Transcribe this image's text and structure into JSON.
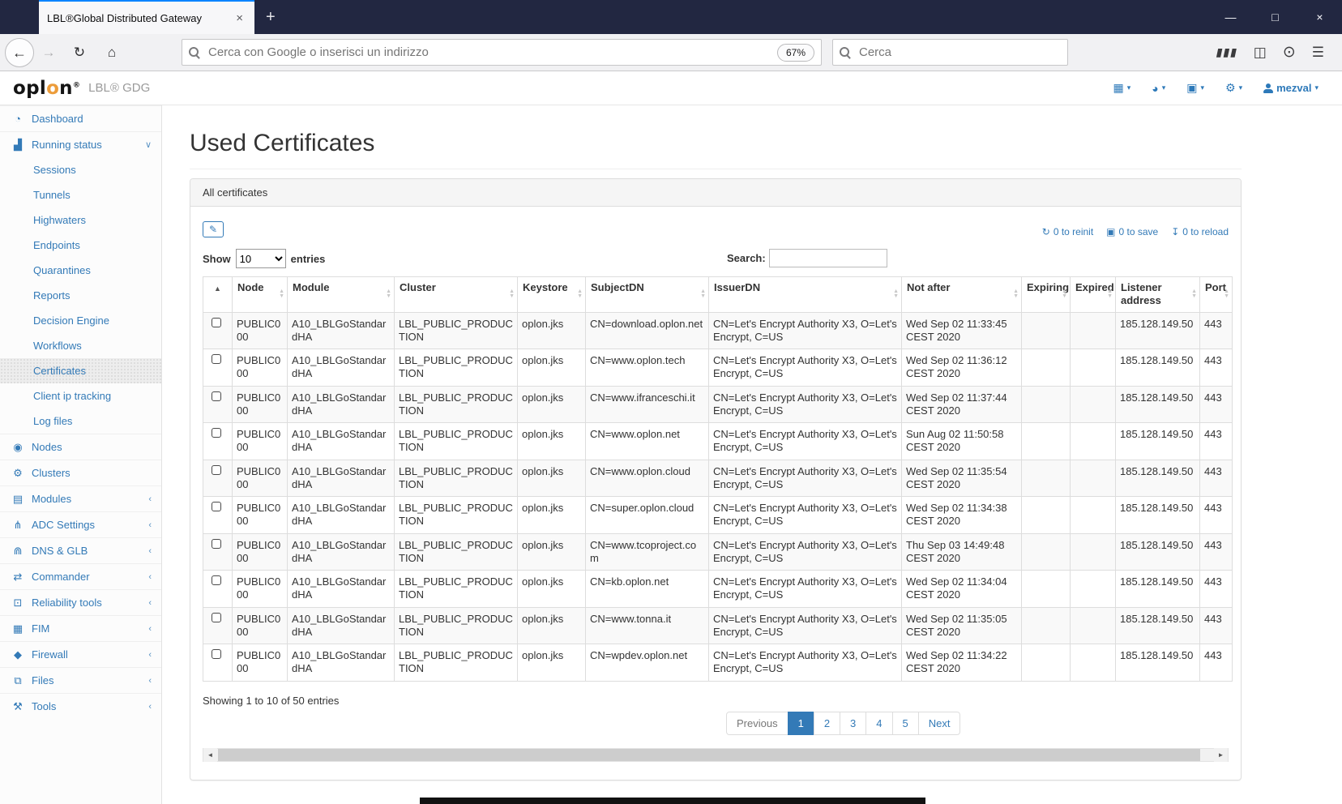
{
  "colors": {
    "accent_blue": "#337ab7",
    "header_icon_blue": "#2d79b9",
    "logo_orange": "#ec9c3a",
    "tabbar_bg": "#222741",
    "tab_accent": "#0a84ff",
    "active_page_bg": "#337ab7",
    "panel_header_bg": "#f5f5f5",
    "row_stripe": "#f9f9f9"
  },
  "browser": {
    "tab": {
      "title": "LBL®Global Distributed Gateway",
      "close": "×",
      "new_tab": "+"
    },
    "window_controls": {
      "minimize": "—",
      "maximize": "□",
      "close": "×"
    },
    "toolbar": {
      "back": "←",
      "forward": "→",
      "reload": "↻",
      "home": "⌂",
      "url_placeholder": "Cerca con Google o inserisci un indirizzo",
      "zoom_badge": "67%",
      "search_placeholder": "Cerca",
      "library_glyph": "▮▮▮",
      "sidebar_glyph": "◫",
      "account_glyph": "⊙",
      "menu_glyph": "☰"
    }
  },
  "app_header": {
    "logo": {
      "pre": "opl",
      "accent": "o",
      "post": "n",
      "reg": "®"
    },
    "product": "LBL® GDG",
    "menus": [
      {
        "name": "apps-menu",
        "icon": "grid-icon",
        "glyph": "▦"
      },
      {
        "name": "dashboard-menu",
        "icon": "gauge-icon",
        "glyph": "◕"
      },
      {
        "name": "save-menu",
        "icon": "floppy-icon",
        "glyph": "▣"
      },
      {
        "name": "settings-menu",
        "icon": "gear-icon",
        "glyph": "⚙"
      }
    ],
    "user_menu": {
      "label": "mezval"
    }
  },
  "sidebar": {
    "items": [
      {
        "label": "Dashboard",
        "icon": "speedometer-icon",
        "glyph": "◔"
      },
      {
        "label": "Running status",
        "icon": "bar-chart-icon",
        "glyph": "▟",
        "state": "expanded",
        "children": [
          "Sessions",
          "Tunnels",
          "Highwaters",
          "Endpoints",
          "Quarantines",
          "Reports",
          "Decision Engine",
          "Workflows",
          "Certificates",
          "Client ip tracking",
          "Log files"
        ],
        "active_child": "Certificates"
      },
      {
        "label": "Nodes",
        "icon": "globe-icon",
        "glyph": "◉"
      },
      {
        "label": "Clusters",
        "icon": "gears-icon",
        "glyph": "⚙"
      },
      {
        "label": "Modules",
        "icon": "list-icon",
        "glyph": "▤",
        "state": "collapsed"
      },
      {
        "label": "ADC Settings",
        "icon": "sitemap-icon",
        "glyph": "⋔",
        "state": "collapsed"
      },
      {
        "label": "DNS & GLB",
        "icon": "binoculars-icon",
        "glyph": "⋒",
        "state": "collapsed"
      },
      {
        "label": "Commander",
        "icon": "shuffle-icon",
        "glyph": "⇄",
        "state": "collapsed"
      },
      {
        "label": "Reliability tools",
        "icon": "desktop-icon",
        "glyph": "⊡",
        "state": "collapsed"
      },
      {
        "label": "FIM",
        "icon": "image-icon",
        "glyph": "▦",
        "state": "collapsed"
      },
      {
        "label": "Firewall",
        "icon": "shield-icon",
        "glyph": "◆",
        "state": "collapsed"
      },
      {
        "label": "Files",
        "icon": "copy-icon",
        "glyph": "⧉",
        "state": "collapsed"
      },
      {
        "label": "Tools",
        "icon": "wrench-icon",
        "glyph": "⚒",
        "state": "collapsed"
      }
    ]
  },
  "main": {
    "title": "Used Certificates",
    "panel": {
      "header": "All certificates",
      "edit_button": {
        "icon": "edit-icon",
        "glyph": "✎"
      },
      "actions": [
        {
          "label": "0 to reinit",
          "icon": "refresh-icon",
          "glyph": "↻"
        },
        {
          "label": "0 to save",
          "icon": "save-icon",
          "glyph": "▣"
        },
        {
          "label": "0 to reload",
          "icon": "download-icon",
          "glyph": "↧"
        }
      ],
      "length_control": {
        "show": "Show",
        "value": "10",
        "entries": "entries"
      },
      "search_label": "Search:",
      "table": {
        "columns": [
          "Node",
          "Module",
          "Cluster",
          "Keystore",
          "SubjectDN",
          "IssuerDN",
          "Not after",
          "Expiring",
          "Expired",
          "Listener address",
          "Port"
        ],
        "rows": [
          {
            "node": "PUBLIC000",
            "module": "A10_LBLGoStandardHA",
            "cluster": "LBL_PUBLIC_PRODUCTION",
            "keystore": "oplon.jks",
            "subject": "CN=download.oplon.net",
            "issuer": "CN=Let's Encrypt Authority X3, O=Let's Encrypt, C=US",
            "not_after": "Wed Sep 02 11:33:45 CEST 2020",
            "expiring": "",
            "expired": "",
            "listener": "185.128.149.50",
            "port": "443"
          },
          {
            "node": "PUBLIC000",
            "module": "A10_LBLGoStandardHA",
            "cluster": "LBL_PUBLIC_PRODUCTION",
            "keystore": "oplon.jks",
            "subject": "CN=www.oplon.tech",
            "issuer": "CN=Let's Encrypt Authority X3, O=Let's Encrypt, C=US",
            "not_after": "Wed Sep 02 11:36:12 CEST 2020",
            "expiring": "",
            "expired": "",
            "listener": "185.128.149.50",
            "port": "443"
          },
          {
            "node": "PUBLIC000",
            "module": "A10_LBLGoStandardHA",
            "cluster": "LBL_PUBLIC_PRODUCTION",
            "keystore": "oplon.jks",
            "subject": "CN=www.ifranceschi.it",
            "issuer": "CN=Let's Encrypt Authority X3, O=Let's Encrypt, C=US",
            "not_after": "Wed Sep 02 11:37:44 CEST 2020",
            "expiring": "",
            "expired": "",
            "listener": "185.128.149.50",
            "port": "443"
          },
          {
            "node": "PUBLIC000",
            "module": "A10_LBLGoStandardHA",
            "cluster": "LBL_PUBLIC_PRODUCTION",
            "keystore": "oplon.jks",
            "subject": "CN=www.oplon.net",
            "issuer": "CN=Let's Encrypt Authority X3, O=Let's Encrypt, C=US",
            "not_after": "Sun Aug 02 11:50:58 CEST 2020",
            "expiring": "",
            "expired": "",
            "listener": "185.128.149.50",
            "port": "443"
          },
          {
            "node": "PUBLIC000",
            "module": "A10_LBLGoStandardHA",
            "cluster": "LBL_PUBLIC_PRODUCTION",
            "keystore": "oplon.jks",
            "subject": "CN=www.oplon.cloud",
            "issuer": "CN=Let's Encrypt Authority X3, O=Let's Encrypt, C=US",
            "not_after": "Wed Sep 02 11:35:54 CEST 2020",
            "expiring": "",
            "expired": "",
            "listener": "185.128.149.50",
            "port": "443"
          },
          {
            "node": "PUBLIC000",
            "module": "A10_LBLGoStandardHA",
            "cluster": "LBL_PUBLIC_PRODUCTION",
            "keystore": "oplon.jks",
            "subject": "CN=super.oplon.cloud",
            "issuer": "CN=Let's Encrypt Authority X3, O=Let's Encrypt, C=US",
            "not_after": "Wed Sep 02 11:34:38 CEST 2020",
            "expiring": "",
            "expired": "",
            "listener": "185.128.149.50",
            "port": "443"
          },
          {
            "node": "PUBLIC000",
            "module": "A10_LBLGoStandardHA",
            "cluster": "LBL_PUBLIC_PRODUCTION",
            "keystore": "oplon.jks",
            "subject": "CN=www.tcoproject.com",
            "issuer": "CN=Let's Encrypt Authority X3, O=Let's Encrypt, C=US",
            "not_after": "Thu Sep 03 14:49:48 CEST 2020",
            "expiring": "",
            "expired": "",
            "listener": "185.128.149.50",
            "port": "443"
          },
          {
            "node": "PUBLIC000",
            "module": "A10_LBLGoStandardHA",
            "cluster": "LBL_PUBLIC_PRODUCTION",
            "keystore": "oplon.jks",
            "subject": "CN=kb.oplon.net",
            "issuer": "CN=Let's Encrypt Authority X3, O=Let's Encrypt, C=US",
            "not_after": "Wed Sep 02 11:34:04 CEST 2020",
            "expiring": "",
            "expired": "",
            "listener": "185.128.149.50",
            "port": "443"
          },
          {
            "node": "PUBLIC000",
            "module": "A10_LBLGoStandardHA",
            "cluster": "LBL_PUBLIC_PRODUCTION",
            "keystore": "oplon.jks",
            "subject": "CN=www.tonna.it",
            "issuer": "CN=Let's Encrypt Authority X3, O=Let's Encrypt, C=US",
            "not_after": "Wed Sep 02 11:35:05 CEST 2020",
            "expiring": "",
            "expired": "",
            "listener": "185.128.149.50",
            "port": "443"
          },
          {
            "node": "PUBLIC000",
            "module": "A10_LBLGoStandardHA",
            "cluster": "LBL_PUBLIC_PRODUCTION",
            "keystore": "oplon.jks",
            "subject": "CN=wpdev.oplon.net",
            "issuer": "CN=Let's Encrypt Authority X3, O=Let's Encrypt, C=US",
            "not_after": "Wed Sep 02 11:34:22 CEST 2020",
            "expiring": "",
            "expired": "",
            "listener": "185.128.149.50",
            "port": "443"
          }
        ]
      },
      "info": "Showing 1 to 10 of 50 entries",
      "pagination": {
        "previous": "Previous",
        "pages": [
          "1",
          "2",
          "3",
          "4",
          "5"
        ],
        "active_page": "1",
        "next": "Next"
      }
    }
  }
}
